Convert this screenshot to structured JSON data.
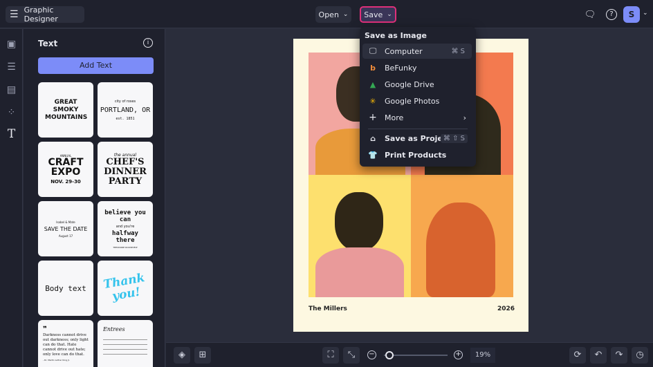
{
  "header": {
    "app_title": "Graphic Designer",
    "open_label": "Open",
    "save_label": "Save",
    "avatar_initial": "S"
  },
  "panel": {
    "title": "Text",
    "add_text_label": "Add Text",
    "tiles": {
      "t1": "GREAT SMOKY MOUNTAINS",
      "t2a": "city of roses",
      "t2b": "PORTLAND, OR",
      "t2c": "est. 1851",
      "t3a": "ANNUAL",
      "t3b": "CRAFT EXPO",
      "t3c": "NOV. 29-30",
      "t4a": "the annual",
      "t4b": "CHEF'S DINNER PARTY",
      "t5a": "Isabel & Mate",
      "t5b": "SAVE THE DATE",
      "t5c": "August 17",
      "t6a": "believe you can",
      "t6b": "and you're",
      "t6c": "halfway there",
      "t6d": "THEODORE ROOSEVELT",
      "t7": "Body text",
      "t8": "Thank you!",
      "t9": "Darkness cannot drive out darkness; only light can do that. Hate cannot drive out hate; only love can do that.",
      "t9b": "- Dr. Martin Luther King Jr.",
      "t10": "Entrees"
    }
  },
  "poster": {
    "left_caption": "The Millers",
    "right_caption": "2026"
  },
  "save_menu": {
    "section_title": "Save as Image",
    "items": [
      {
        "label": "Computer",
        "shortcut": "⌘ S"
      },
      {
        "label": "BeFunky"
      },
      {
        "label": "Google Drive"
      },
      {
        "label": "Google Photos"
      },
      {
        "label": "More"
      }
    ],
    "project": {
      "label": "Save as Project",
      "shortcut": "⌘ ⇧ S"
    },
    "print": {
      "label": "Print Products"
    }
  },
  "bottom": {
    "zoom": "19%",
    "zoom_fraction": 0.19
  },
  "colors": {
    "accent": "#7c8cf8",
    "save_highlight": "#e0307a"
  }
}
